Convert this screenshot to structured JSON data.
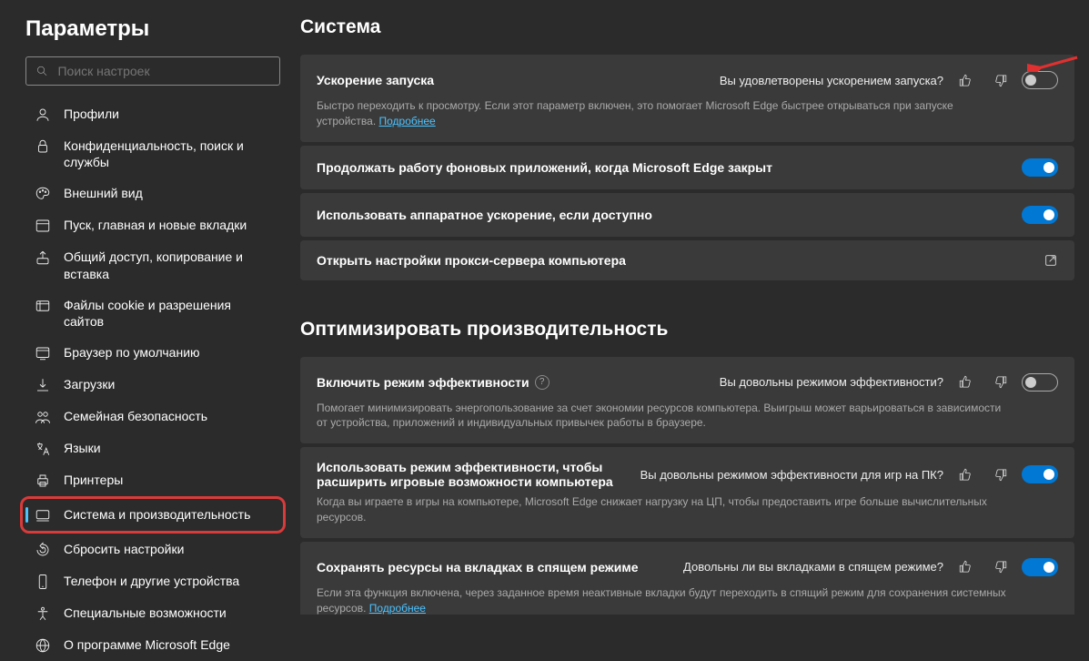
{
  "page_title": "Параметры",
  "search_placeholder": "Поиск настроек",
  "sidebar": [
    {
      "key": "profiles",
      "label": "Профили"
    },
    {
      "key": "privacy",
      "label": "Конфиденциальность, поиск и службы"
    },
    {
      "key": "appearance",
      "label": "Внешний вид"
    },
    {
      "key": "start",
      "label": "Пуск, главная и новые вкладки"
    },
    {
      "key": "share",
      "label": "Общий доступ, копирование и вставка"
    },
    {
      "key": "cookies",
      "label": "Файлы cookie и разрешения сайтов"
    },
    {
      "key": "default",
      "label": "Браузер по умолчанию"
    },
    {
      "key": "downloads",
      "label": "Загрузки"
    },
    {
      "key": "family",
      "label": "Семейная безопасность"
    },
    {
      "key": "languages",
      "label": "Языки"
    },
    {
      "key": "printers",
      "label": "Принтеры"
    },
    {
      "key": "system",
      "label": "Система и производительность"
    },
    {
      "key": "reset",
      "label": "Сбросить настройки"
    },
    {
      "key": "phone",
      "label": "Телефон и другие устройства"
    },
    {
      "key": "accessibility",
      "label": "Специальные возможности"
    },
    {
      "key": "about",
      "label": "О программе Microsoft Edge"
    }
  ],
  "section1_title": "Система",
  "section2_title": "Оптимизировать производительность",
  "more_label": "Подробнее",
  "cards": {
    "startup": {
      "title": "Ускорение запуска",
      "q": "Вы удовлетворены ускорением запуска?",
      "desc": "Быстро переходить к просмотру. Если этот параметр включен, это помогает Microsoft Edge быстрее открываться при запуске устройства.",
      "toggle": "off"
    },
    "background": {
      "title": "Продолжать работу фоновых приложений, когда Microsoft Edge закрыт",
      "toggle": "on"
    },
    "hardware": {
      "title": "Использовать аппаратное ускорение, если доступно",
      "toggle": "on"
    },
    "proxy": {
      "title": "Открыть настройки прокси-сервера компьютера"
    },
    "efficiency": {
      "title": "Включить режим эффективности",
      "q": "Вы довольны режимом эффективности?",
      "desc": "Помогает минимизировать энергопользование за счет экономии ресурсов компьютера. Выигрыш может варьироваться в зависимости от устройства, приложений и индивидуальных привычек работы в браузере.",
      "toggle": "off"
    },
    "gaming": {
      "title": "Использовать режим эффективности, чтобы расширить игровые возможности компьютера",
      "q": "Вы довольны режимом эффективности для игр на ПК?",
      "desc": "Когда вы играете в игры на компьютере, Microsoft Edge снижает нагрузку на ЦП, чтобы предоставить игре больше вычислительных ресурсов.",
      "toggle": "on"
    },
    "sleep": {
      "title": "Сохранять ресурсы на вкладках в спящем режиме",
      "q": "Довольны ли вы вкладками в спящем режиме?",
      "desc": "Если эта функция включена, через заданное время неактивные вкладки будут переходить в спящий режим для сохранения системных ресурсов.",
      "toggle": "on"
    }
  }
}
